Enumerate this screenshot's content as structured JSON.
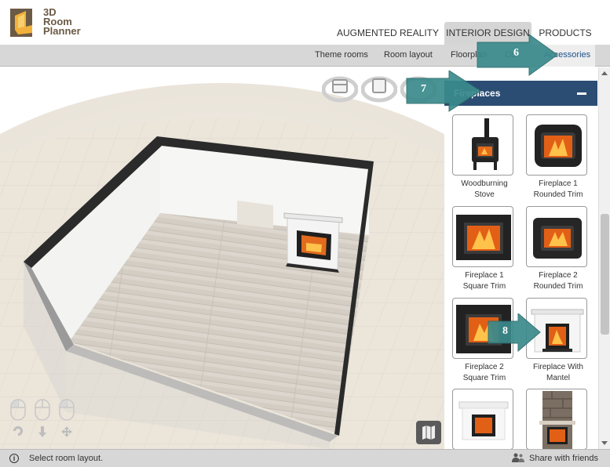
{
  "header": {
    "logo_line1": "3D",
    "logo_line2": "Room",
    "logo_line3": "Planner",
    "nav": [
      {
        "label": "AUGMENTED REALITY"
      },
      {
        "label": "INTERIOR DESIGN",
        "active": true
      },
      {
        "label": "PRODUCTS"
      }
    ]
  },
  "subnav": {
    "items": [
      {
        "label": "Theme rooms"
      },
      {
        "label": "Room layout"
      },
      {
        "label": "Floorplan"
      },
      {
        "label": "Co"
      },
      {
        "label": "Accessories",
        "active": true
      }
    ]
  },
  "panel": {
    "title": "Fireplaces",
    "items": [
      {
        "label": "Woodburning Stove",
        "icon": "woodburning-stove"
      },
      {
        "label": "Fireplace 1 Rounded Trim",
        "icon": "fireplace-rounded"
      },
      {
        "label": "Fireplace 1 Square Trim",
        "icon": "fireplace-square"
      },
      {
        "label": "Fireplace 2 Rounded Trim",
        "icon": "fireplace-rounded-2"
      },
      {
        "label": "Fireplace 2 Square Trim",
        "icon": "fireplace-square-2"
      },
      {
        "label": "Fireplace With Mantel",
        "icon": "fireplace-mantel"
      },
      {
        "label": "",
        "icon": "fireplace-white-mantel"
      },
      {
        "label": "",
        "icon": "fireplace-stone"
      }
    ]
  },
  "callouts": {
    "step6": "6",
    "step7": "7",
    "step8": "8"
  },
  "footer": {
    "status": "Select room layout.",
    "share": "Share with friends"
  },
  "colors": {
    "panel_header": "#2c4d73",
    "callout": "#3a8a8c",
    "floor": "#d8d2ca",
    "toolbar": "#d7d7d7"
  }
}
